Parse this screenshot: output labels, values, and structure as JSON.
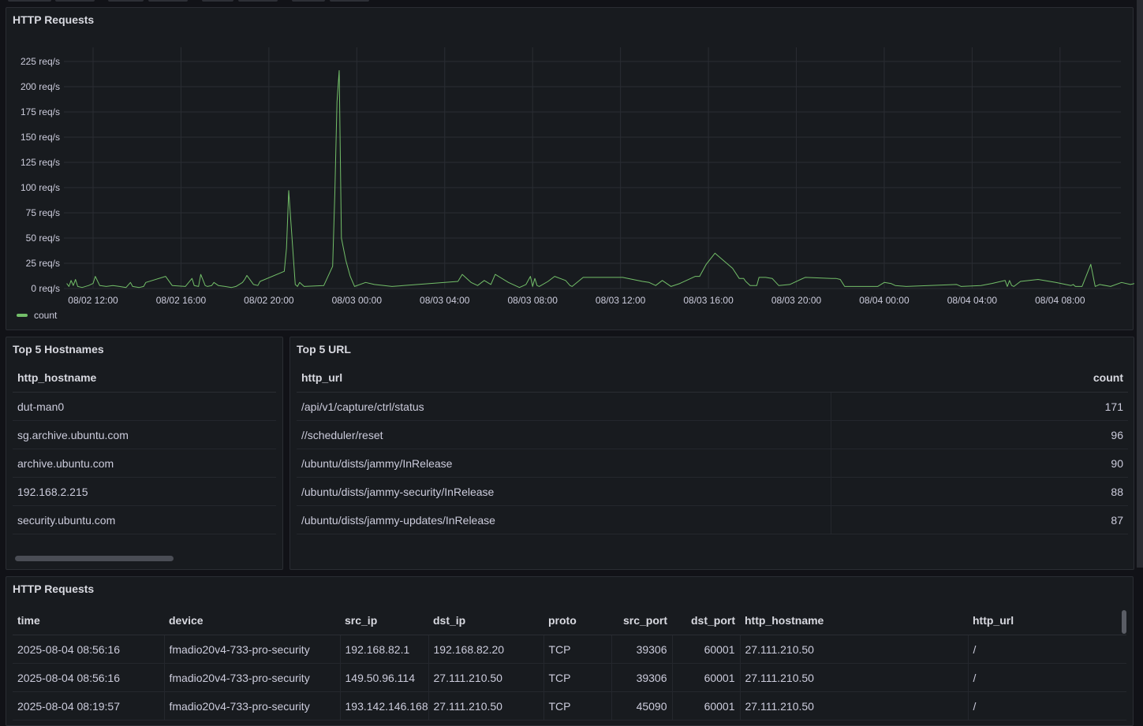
{
  "top_tabs": [
    {
      "left": 10,
      "width": 55
    },
    {
      "left": 70,
      "width": 50
    },
    {
      "left": 137,
      "width": 45
    },
    {
      "left": 188,
      "width": 50
    },
    {
      "left": 256,
      "width": 40
    },
    {
      "left": 302,
      "width": 50
    },
    {
      "left": 370,
      "width": 42
    },
    {
      "left": 418,
      "width": 50
    }
  ],
  "chart_panel": {
    "title": "HTTP Requests",
    "legend_label": "count",
    "series_color": "#73bf69"
  },
  "chart_data": {
    "type": "line",
    "title": "HTTP Requests",
    "ylabel": "",
    "xlabel": "",
    "ylim": [
      0,
      225
    ],
    "y_ticks": [
      "0 req/s",
      "25 req/s",
      "50 req/s",
      "75 req/s",
      "100 req/s",
      "125 req/s",
      "150 req/s",
      "175 req/s",
      "200 req/s",
      "225 req/s"
    ],
    "x_ticks": [
      "08/02 12:00",
      "08/02 16:00",
      "08/02 20:00",
      "08/03 00:00",
      "08/03 04:00",
      "08/03 08:00",
      "08/03 12:00",
      "08/03 16:00",
      "08/03 20:00",
      "08/04 00:00",
      "08/04 04:00",
      "08/04 08:00"
    ],
    "x_range_hours": [
      -1.4,
      45.2
    ],
    "legend": "bottom-left",
    "grid": true,
    "series": [
      {
        "name": "count",
        "color": "#73bf69",
        "points": [
          [
            -1.2,
            5
          ],
          [
            -1.1,
            2
          ],
          [
            -1.0,
            8
          ],
          [
            -0.9,
            3
          ],
          [
            -0.8,
            9
          ],
          [
            -0.7,
            2
          ],
          [
            -0.5,
            1
          ],
          [
            -0.2,
            3
          ],
          [
            0.0,
            5
          ],
          [
            0.1,
            12
          ],
          [
            0.3,
            3
          ],
          [
            0.6,
            2
          ],
          [
            0.9,
            3
          ],
          [
            1.2,
            2
          ],
          [
            1.5,
            1
          ],
          [
            1.7,
            6
          ],
          [
            1.8,
            2
          ],
          [
            2.1,
            1
          ],
          [
            2.3,
            2
          ],
          [
            2.4,
            6
          ],
          [
            3.3,
            12
          ],
          [
            3.6,
            3
          ],
          [
            4.2,
            2
          ],
          [
            4.5,
            10
          ],
          [
            4.6,
            3
          ],
          [
            4.8,
            2
          ],
          [
            4.9,
            14
          ],
          [
            5.1,
            3
          ],
          [
            5.2,
            2
          ],
          [
            5.4,
            3
          ],
          [
            5.5,
            6
          ],
          [
            5.7,
            3
          ],
          [
            6.0,
            2
          ],
          [
            6.3,
            1
          ],
          [
            6.5,
            2
          ],
          [
            6.8,
            6
          ],
          [
            6.9,
            9
          ],
          [
            7.0,
            13
          ],
          [
            7.3,
            4
          ],
          [
            7.5,
            3
          ],
          [
            7.6,
            7
          ],
          [
            8.7,
            17
          ],
          [
            8.8,
            40
          ],
          [
            8.9,
            97
          ],
          [
            9.2,
            4
          ],
          [
            9.3,
            2
          ],
          [
            9.4,
            6
          ],
          [
            9.6,
            2
          ],
          [
            10.5,
            3
          ],
          [
            10.9,
            22
          ],
          [
            11.0,
            95
          ],
          [
            11.1,
            185
          ],
          [
            11.2,
            216
          ],
          [
            11.3,
            50
          ],
          [
            11.5,
            28
          ],
          [
            11.7,
            12
          ],
          [
            11.9,
            2
          ],
          [
            12.4,
            6
          ],
          [
            12.8,
            4
          ],
          [
            13.6,
            2
          ],
          [
            16.6,
            7
          ],
          [
            16.8,
            14
          ],
          [
            17.2,
            6
          ],
          [
            17.5,
            3
          ],
          [
            17.8,
            8
          ],
          [
            18.1,
            4
          ],
          [
            18.3,
            14
          ],
          [
            18.9,
            6
          ],
          [
            19.4,
            1
          ],
          [
            19.5,
            2
          ],
          [
            19.7,
            4
          ],
          [
            19.9,
            12
          ],
          [
            20.0,
            2
          ],
          [
            20.1,
            10
          ],
          [
            20.2,
            3
          ],
          [
            20.3,
            2
          ],
          [
            20.7,
            7
          ],
          [
            21.0,
            12
          ],
          [
            21.5,
            8
          ],
          [
            21.7,
            3
          ],
          [
            21.8,
            2
          ],
          [
            22.3,
            11
          ],
          [
            23.7,
            11
          ],
          [
            24.1,
            11
          ],
          [
            25.0,
            7
          ],
          [
            25.3,
            6
          ],
          [
            25.6,
            3
          ],
          [
            25.9,
            8
          ],
          [
            26.3,
            2
          ],
          [
            26.7,
            5
          ],
          [
            27.2,
            10
          ],
          [
            27.4,
            12
          ],
          [
            27.6,
            12
          ],
          [
            27.9,
            24
          ],
          [
            28.3,
            35
          ],
          [
            29.1,
            20
          ],
          [
            29.4,
            10
          ],
          [
            29.6,
            10
          ],
          [
            29.7,
            7
          ],
          [
            29.9,
            3
          ],
          [
            30.2,
            3
          ],
          [
            30.3,
            11
          ],
          [
            30.6,
            11
          ],
          [
            30.9,
            10
          ],
          [
            31.2,
            3
          ],
          [
            31.7,
            4
          ],
          [
            32.4,
            11
          ],
          [
            33.6,
            10
          ],
          [
            33.8,
            10
          ],
          [
            34.0,
            9
          ],
          [
            34.2,
            2
          ],
          [
            35.6,
            2
          ],
          [
            35.7,
            2
          ],
          [
            36.0,
            6
          ],
          [
            36.3,
            5
          ],
          [
            36.5,
            3
          ],
          [
            37.0,
            2
          ],
          [
            39.3,
            4
          ],
          [
            39.5,
            2
          ],
          [
            40.4,
            3
          ],
          [
            40.9,
            5
          ],
          [
            41.5,
            8
          ],
          [
            41.6,
            2
          ],
          [
            41.7,
            8
          ],
          [
            41.8,
            3
          ],
          [
            41.9,
            2
          ],
          [
            42.2,
            7
          ],
          [
            43.0,
            9
          ],
          [
            43.8,
            6
          ],
          [
            44.5,
            3
          ],
          [
            44.6,
            4
          ],
          [
            44.7,
            2
          ],
          [
            45.0,
            2
          ],
          [
            45.4,
            24
          ],
          [
            45.6,
            2
          ],
          [
            45.8,
            4
          ],
          [
            46.3,
            2
          ],
          [
            46.8,
            6
          ],
          [
            47.2,
            4
          ],
          [
            47.4,
            5
          ],
          [
            47.7,
            3
          ],
          [
            48.1,
            2
          ],
          [
            48.9,
            2
          ],
          [
            49.2,
            32
          ],
          [
            49.5,
            12
          ],
          [
            49.8,
            4
          ],
          [
            50.1,
            2
          ],
          [
            50.4,
            2
          ],
          [
            50.7,
            6
          ],
          [
            51.1,
            6
          ],
          [
            51.6,
            3
          ],
          [
            52.1,
            3
          ],
          [
            52.3,
            2
          ],
          [
            53.1,
            2
          ]
        ]
      }
    ]
  },
  "hosts_panel": {
    "title": "Top 5 Hostnames",
    "columns": [
      "http_hostname"
    ],
    "rows": [
      [
        "dut-man0"
      ],
      [
        "sg.archive.ubuntu.com"
      ],
      [
        "archive.ubuntu.com"
      ],
      [
        "192.168.2.215"
      ],
      [
        "security.ubuntu.com"
      ]
    ]
  },
  "urls_panel": {
    "title": "Top 5 URL",
    "columns": [
      "http_url",
      "count"
    ],
    "rows": [
      [
        "/api/v1/capture/ctrl/status",
        "171"
      ],
      [
        "//scheduler/reset",
        "96"
      ],
      [
        "/ubuntu/dists/jammy/InRelease",
        "90"
      ],
      [
        "/ubuntu/dists/jammy-security/InRelease",
        "88"
      ],
      [
        "/ubuntu/dists/jammy-updates/InRelease",
        "87"
      ]
    ]
  },
  "requests_panel": {
    "title": "HTTP Requests",
    "columns": [
      "time",
      "device",
      "src_ip",
      "dst_ip",
      "proto",
      "src_port",
      "dst_port",
      "http_hostname",
      "http_url"
    ],
    "rows": [
      [
        "2025-08-04 08:56:16",
        "fmadio20v4-733-pro-security",
        "192.168.82.1",
        "192.168.82.20",
        "TCP",
        "39306",
        "60001",
        "27.111.210.50",
        "/"
      ],
      [
        "2025-08-04 08:56:16",
        "fmadio20v4-733-pro-security",
        "149.50.96.114",
        "27.111.210.50",
        "TCP",
        "39306",
        "60001",
        "27.111.210.50",
        "/"
      ],
      [
        "2025-08-04 08:19:57",
        "fmadio20v4-733-pro-security",
        "193.142.146.168",
        "27.111.210.50",
        "TCP",
        "45090",
        "60001",
        "27.111.210.50",
        "/"
      ]
    ]
  }
}
